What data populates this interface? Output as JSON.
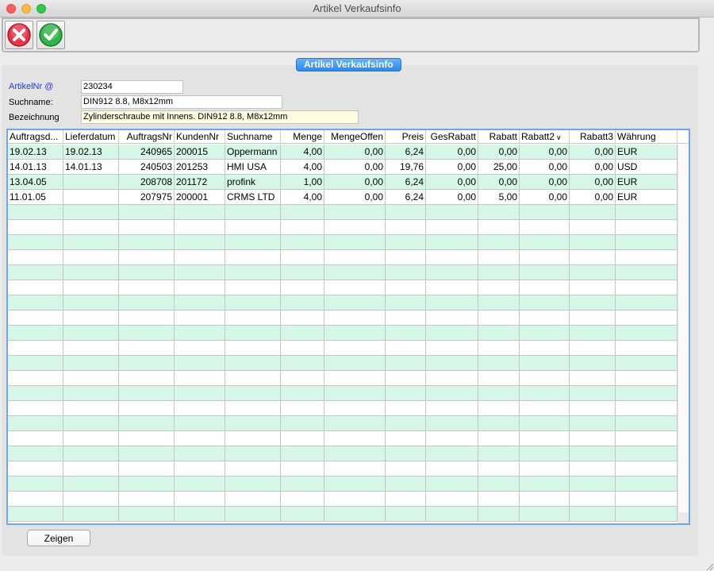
{
  "window": {
    "title": "Artikel Verkaufsinfo"
  },
  "toolbar": {
    "cancel_icon": "cancel-x-icon",
    "ok_icon": "checkmark-icon"
  },
  "panel": {
    "title": "Artikel Verkaufsinfo"
  },
  "form": {
    "artikelnr_label": "ArtikelNr @",
    "artikelnr_value": "230234",
    "suchname_label": "Suchname:",
    "suchname_value": "DIN912 8.8, M8x12mm",
    "bezeichnung_label": "Bezeichnung",
    "bezeichnung_value": "Zylinderschraube mit Innens. DIN912 8.8, M8x12mm"
  },
  "table": {
    "columns": [
      "Auftragsd...",
      "Lieferdatum",
      "AuftragsNr",
      "KundenNr",
      "Suchname",
      "Menge",
      "MengeOffen",
      "Preis",
      "GesRabatt",
      "Rabatt",
      "Rabatt2",
      "Rabatt3",
      "Währung"
    ],
    "rows": [
      [
        "19.02.13",
        "19.02.13",
        "240965",
        "200015",
        "Oppermann",
        "4,00",
        "0,00",
        "6,24",
        "0,00",
        "0,00",
        "0,00",
        "0,00",
        "EUR"
      ],
      [
        "14.01.13",
        "14.01.13",
        "240503",
        "201253",
        "HMI USA",
        "4,00",
        "0,00",
        "19,76",
        "0,00",
        "25,00",
        "0,00",
        "0,00",
        "USD"
      ],
      [
        "13.04.05",
        "",
        "208708",
        "201172",
        "profink",
        "1,00",
        "0,00",
        "6,24",
        "0,00",
        "0,00",
        "0,00",
        "0,00",
        "EUR"
      ],
      [
        "11.01.05",
        "",
        "207975",
        "200001",
        "CRMS LTD",
        "4,00",
        "0,00",
        "6,24",
        "0,00",
        "5,00",
        "0,00",
        "0,00",
        "EUR"
      ]
    ],
    "sort_column": "Rabatt2"
  },
  "buttons": {
    "zeigen": "Zeigen"
  },
  "colors": {
    "row_alt": "#d6f7e7",
    "accent": "#2d86f0",
    "grid_border": "#6ea6e6"
  }
}
